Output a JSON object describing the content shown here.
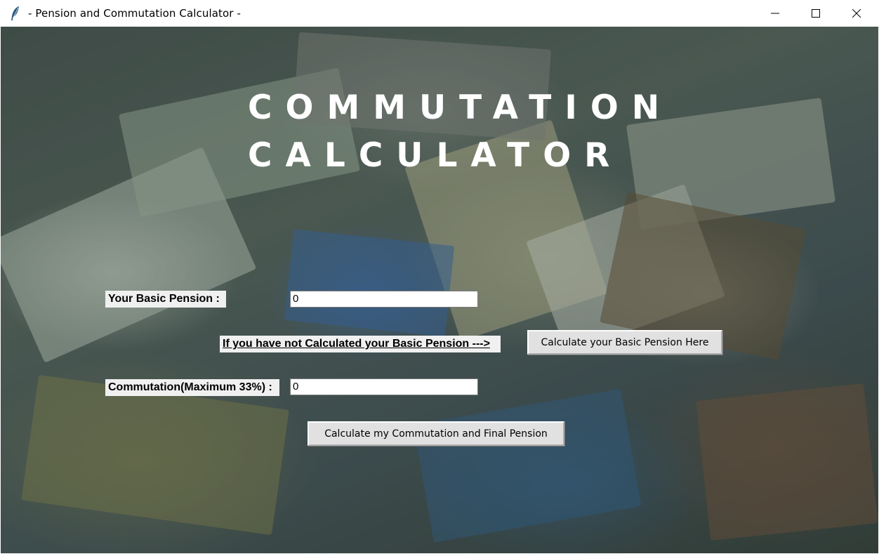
{
  "window": {
    "title": "- Pension and Commutation Calculator -",
    "icons": {
      "app": "feather-icon",
      "minimize": "minimize-icon",
      "maximize": "maximize-icon",
      "close": "close-icon"
    }
  },
  "heading": {
    "line1": "COMMUTATION",
    "line2": "CALCULATOR"
  },
  "form": {
    "basic_pension_label": "Your Basic Pension :",
    "basic_pension_value": "0",
    "not_calculated_link": "If you have not Calculated your Basic Pension --->",
    "calc_basic_button": "Calculate your Basic Pension Here",
    "commutation_label": "Commutation(Maximum 33%) :",
    "commutation_value": "0",
    "calc_final_button": "Calculate my Commutation and Final Pension"
  }
}
